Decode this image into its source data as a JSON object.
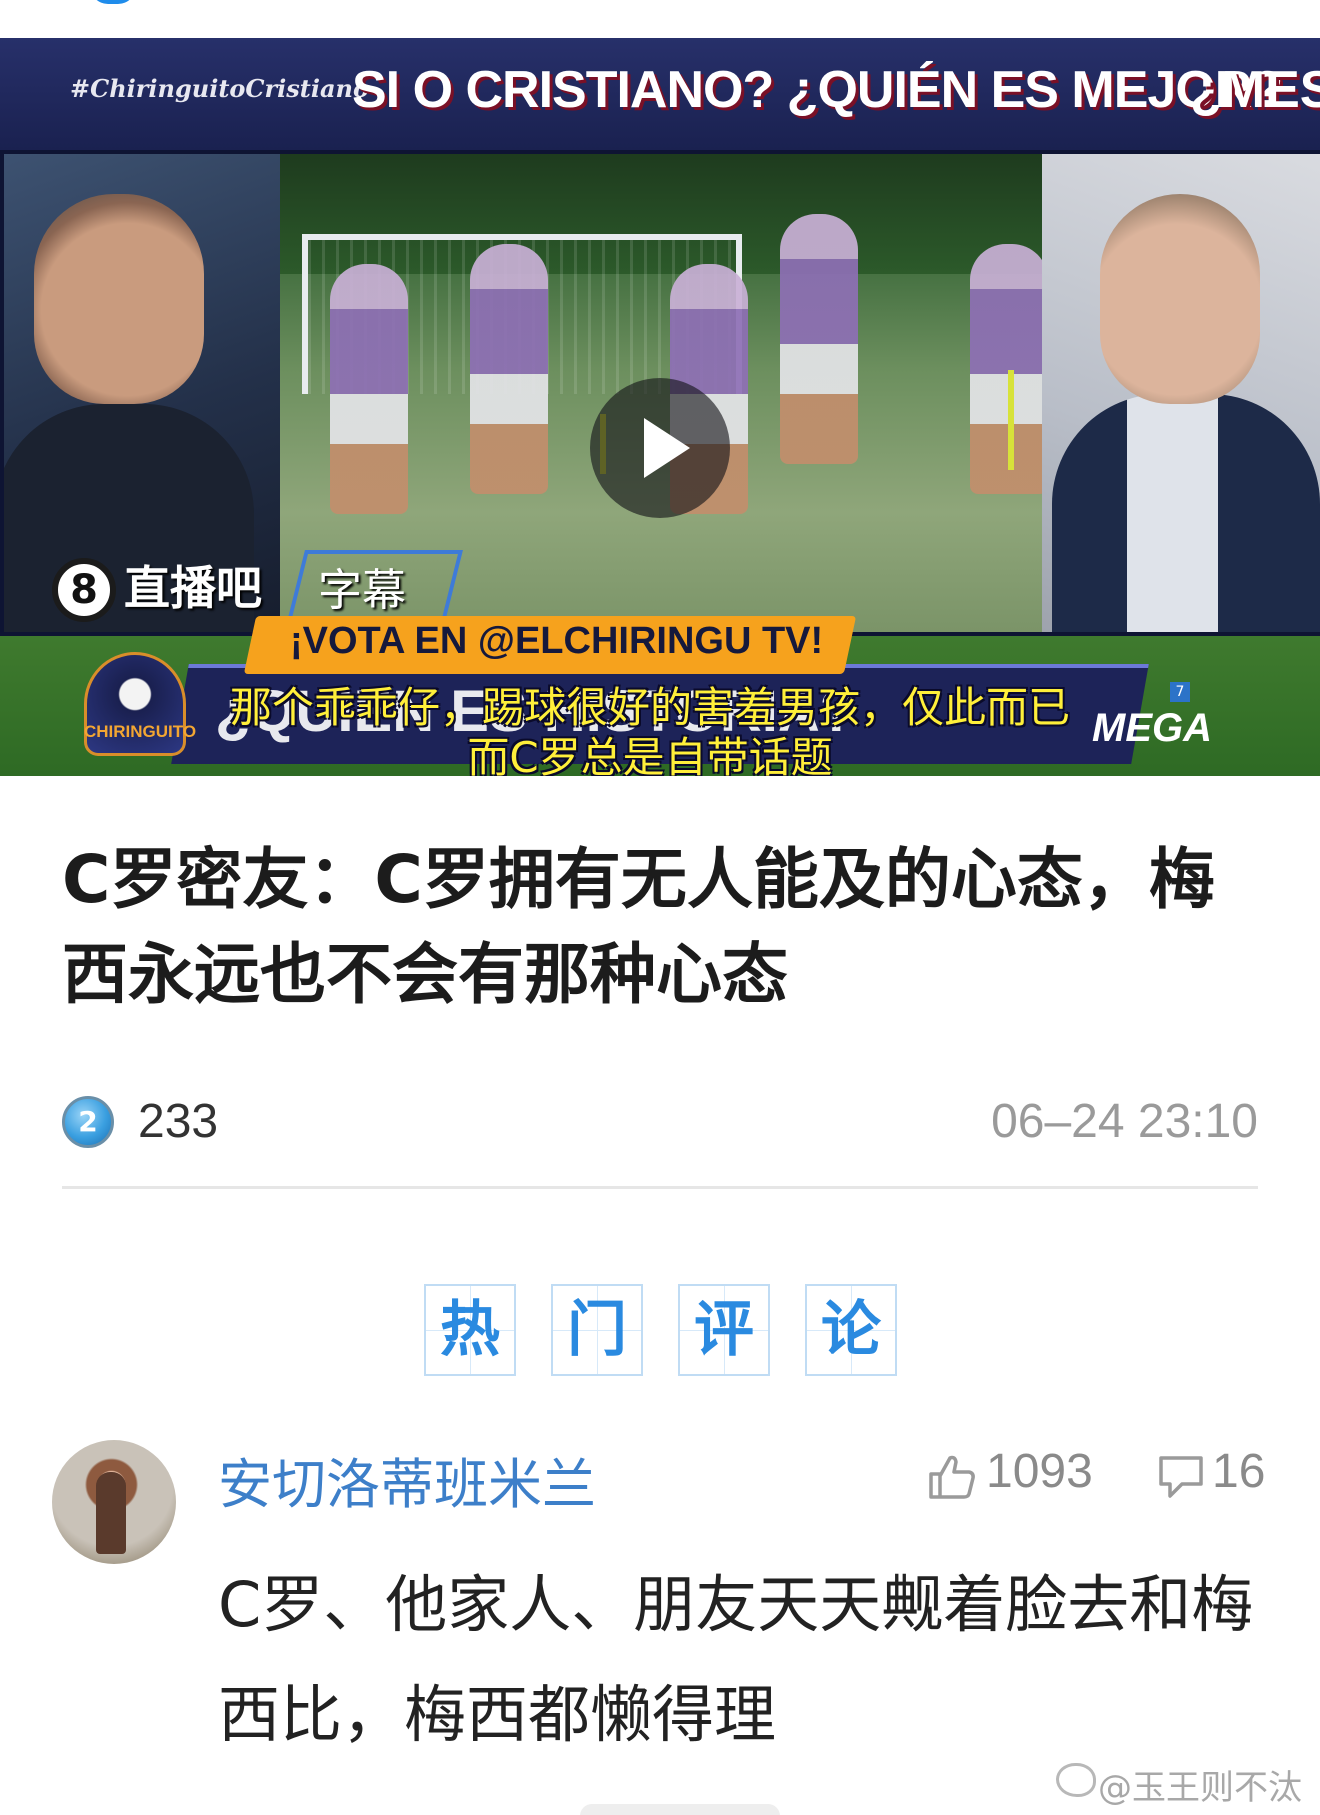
{
  "video": {
    "hashtag": "#ChiringuitoCristiano",
    "headline": "SI O CRISTIANO? ¿QUIÉN ES MEJOR?",
    "headline_right": "¿MESS",
    "brand_badge": "8",
    "brand_name": "直播吧",
    "brand_tag": "字幕",
    "vote_text": "¡VOTA EN @ELCHIRINGU   TV!",
    "banner_text": "¿QUIEN ES                          HISTORIA?",
    "channel_logo": "CHIRINGUITO",
    "network_logo": "MEGA",
    "network_badge": "7",
    "subtitle_line1": "那个乖乖仔，踢球很好的害羞男孩，仅此而已",
    "subtitle_line2": "而C罗总是自带话题",
    "play_icon": "play-icon"
  },
  "article": {
    "title": "C罗密友：C罗拥有无人能及的心态，梅西永远也不会有那种心态",
    "view_badge": "2",
    "view_count": "233",
    "timestamp": "06–24 23:10"
  },
  "section": {
    "heading_chars": [
      "热",
      "门",
      "评",
      "论"
    ]
  },
  "comment": {
    "username": "安切洛蒂班米兰",
    "likes": "1093",
    "replies": "16",
    "text": "C罗、他家人、朋友天天觍着脸去和梅西比，梅西都懒得理"
  },
  "watermark": "@玉王则不汰",
  "colors": {
    "accent_blue": "#2a8ae0",
    "username_blue": "#3d7fc9",
    "subtitle_yellow": "#ffef3a",
    "vote_orange": "#f6a21d"
  }
}
